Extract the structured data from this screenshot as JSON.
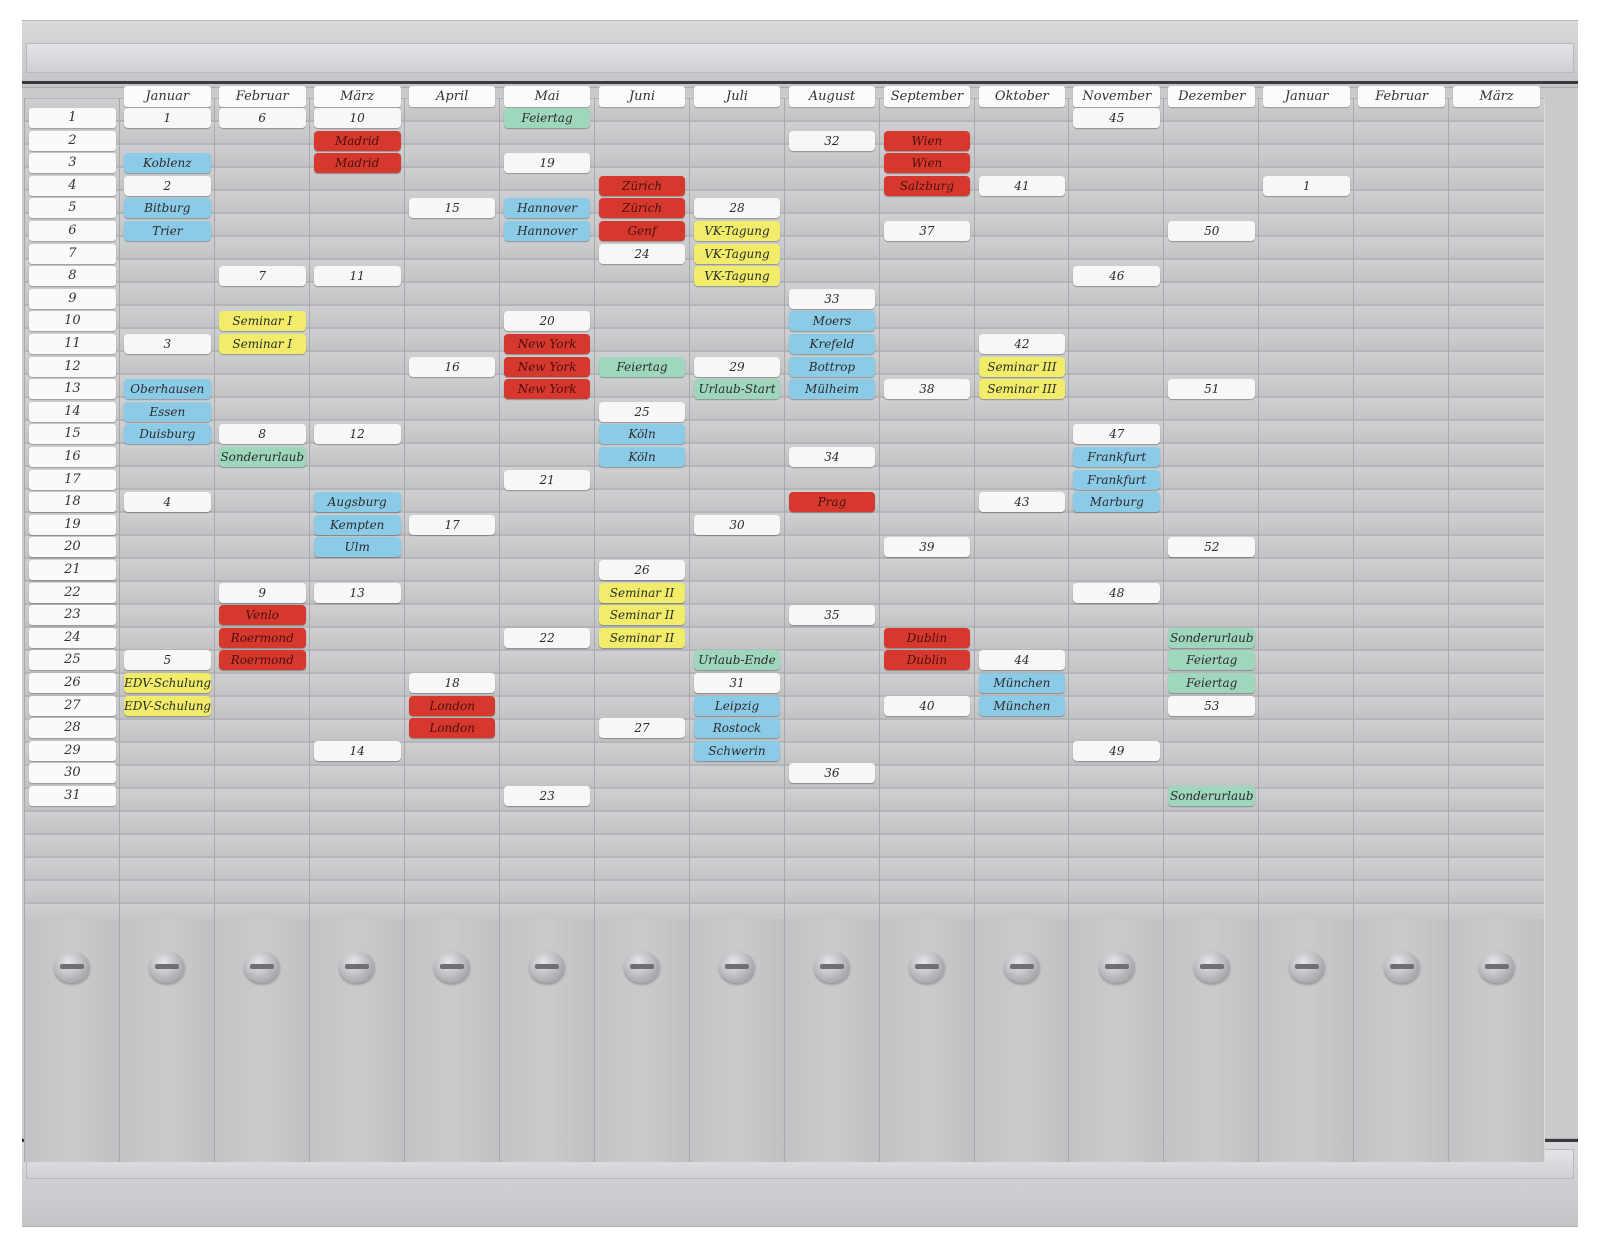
{
  "months": [
    "Januar",
    "Februar",
    "März",
    "April",
    "Mai",
    "Juni",
    "Juli",
    "August",
    "September",
    "Oktober",
    "November",
    "Dezember",
    "Januar",
    "Februar",
    "März"
  ],
  "days": [
    "1",
    "2",
    "3",
    "4",
    "5",
    "6",
    "7",
    "8",
    "9",
    "10",
    "11",
    "12",
    "13",
    "14",
    "15",
    "16",
    "17",
    "18",
    "19",
    "20",
    "21",
    "22",
    "23",
    "24",
    "25",
    "26",
    "27",
    "28",
    "29",
    "30",
    "31"
  ],
  "cards": [
    {
      "col": 1,
      "row": 1,
      "text": "1",
      "color": "white"
    },
    {
      "col": 1,
      "row": 3,
      "text": "Koblenz",
      "color": "blue"
    },
    {
      "col": 1,
      "row": 4,
      "text": "2",
      "color": "white"
    },
    {
      "col": 1,
      "row": 5,
      "text": "Bitburg",
      "color": "blue"
    },
    {
      "col": 1,
      "row": 6,
      "text": "Trier",
      "color": "blue"
    },
    {
      "col": 1,
      "row": 11,
      "text": "3",
      "color": "white"
    },
    {
      "col": 1,
      "row": 13,
      "text": "Oberhausen",
      "color": "blue"
    },
    {
      "col": 1,
      "row": 14,
      "text": "Essen",
      "color": "blue"
    },
    {
      "col": 1,
      "row": 15,
      "text": "Duisburg",
      "color": "blue"
    },
    {
      "col": 1,
      "row": 18,
      "text": "4",
      "color": "white"
    },
    {
      "col": 1,
      "row": 25,
      "text": "5",
      "color": "white"
    },
    {
      "col": 1,
      "row": 26,
      "text": "EDV-Schulung",
      "color": "yellow"
    },
    {
      "col": 1,
      "row": 27,
      "text": "EDV-Schulung",
      "color": "yellow"
    },
    {
      "col": 2,
      "row": 1,
      "text": "6",
      "color": "white"
    },
    {
      "col": 2,
      "row": 8,
      "text": "7",
      "color": "white"
    },
    {
      "col": 2,
      "row": 10,
      "text": "Seminar I",
      "color": "yellow"
    },
    {
      "col": 2,
      "row": 11,
      "text": "Seminar I",
      "color": "yellow"
    },
    {
      "col": 2,
      "row": 15,
      "text": "8",
      "color": "white"
    },
    {
      "col": 2,
      "row": 16,
      "text": "Sonderurlaub",
      "color": "green"
    },
    {
      "col": 2,
      "row": 22,
      "text": "9",
      "color": "white"
    },
    {
      "col": 2,
      "row": 23,
      "text": "Venlo",
      "color": "red"
    },
    {
      "col": 2,
      "row": 24,
      "text": "Roermond",
      "color": "red"
    },
    {
      "col": 2,
      "row": 25,
      "text": "Roermond",
      "color": "red"
    },
    {
      "col": 3,
      "row": 1,
      "text": "10",
      "color": "white"
    },
    {
      "col": 3,
      "row": 2,
      "text": "Madrid",
      "color": "red"
    },
    {
      "col": 3,
      "row": 3,
      "text": "Madrid",
      "color": "red"
    },
    {
      "col": 3,
      "row": 8,
      "text": "11",
      "color": "white"
    },
    {
      "col": 3,
      "row": 15,
      "text": "12",
      "color": "white"
    },
    {
      "col": 3,
      "row": 18,
      "text": "Augsburg",
      "color": "blue"
    },
    {
      "col": 3,
      "row": 19,
      "text": "Kempten",
      "color": "blue"
    },
    {
      "col": 3,
      "row": 20,
      "text": "Ulm",
      "color": "blue"
    },
    {
      "col": 3,
      "row": 22,
      "text": "13",
      "color": "white"
    },
    {
      "col": 3,
      "row": 29,
      "text": "14",
      "color": "white"
    },
    {
      "col": 4,
      "row": 5,
      "text": "15",
      "color": "white"
    },
    {
      "col": 4,
      "row": 12,
      "text": "16",
      "color": "white"
    },
    {
      "col": 4,
      "row": 19,
      "text": "17",
      "color": "white"
    },
    {
      "col": 4,
      "row": 26,
      "text": "18",
      "color": "white"
    },
    {
      "col": 4,
      "row": 27,
      "text": "London",
      "color": "red"
    },
    {
      "col": 4,
      "row": 28,
      "text": "London",
      "color": "red"
    },
    {
      "col": 5,
      "row": 1,
      "text": "Feiertag",
      "color": "green"
    },
    {
      "col": 5,
      "row": 3,
      "text": "19",
      "color": "white"
    },
    {
      "col": 5,
      "row": 5,
      "text": "Hannover",
      "color": "blue"
    },
    {
      "col": 5,
      "row": 6,
      "text": "Hannover",
      "color": "blue"
    },
    {
      "col": 5,
      "row": 10,
      "text": "20",
      "color": "white"
    },
    {
      "col": 5,
      "row": 11,
      "text": "New York",
      "color": "red"
    },
    {
      "col": 5,
      "row": 12,
      "text": "New York",
      "color": "red"
    },
    {
      "col": 5,
      "row": 13,
      "text": "New York",
      "color": "red"
    },
    {
      "col": 5,
      "row": 17,
      "text": "21",
      "color": "white"
    },
    {
      "col": 5,
      "row": 24,
      "text": "22",
      "color": "white"
    },
    {
      "col": 5,
      "row": 31,
      "text": "23",
      "color": "white"
    },
    {
      "col": 6,
      "row": 4,
      "text": "Zürich",
      "color": "red"
    },
    {
      "col": 6,
      "row": 5,
      "text": "Zürich",
      "color": "red"
    },
    {
      "col": 6,
      "row": 6,
      "text": "Genf",
      "color": "red"
    },
    {
      "col": 6,
      "row": 7,
      "text": "24",
      "color": "white"
    },
    {
      "col": 6,
      "row": 12,
      "text": "Feiertag",
      "color": "green"
    },
    {
      "col": 6,
      "row": 14,
      "text": "25",
      "color": "white"
    },
    {
      "col": 6,
      "row": 15,
      "text": "Köln",
      "color": "blue"
    },
    {
      "col": 6,
      "row": 16,
      "text": "Köln",
      "color": "blue"
    },
    {
      "col": 6,
      "row": 21,
      "text": "26",
      "color": "white"
    },
    {
      "col": 6,
      "row": 22,
      "text": "Seminar II",
      "color": "yellow"
    },
    {
      "col": 6,
      "row": 23,
      "text": "Seminar II",
      "color": "yellow"
    },
    {
      "col": 6,
      "row": 24,
      "text": "Seminar II",
      "color": "yellow"
    },
    {
      "col": 6,
      "row": 28,
      "text": "27",
      "color": "white"
    },
    {
      "col": 7,
      "row": 5,
      "text": "28",
      "color": "white"
    },
    {
      "col": 7,
      "row": 6,
      "text": "VK-Tagung",
      "color": "yellow"
    },
    {
      "col": 7,
      "row": 7,
      "text": "VK-Tagung",
      "color": "yellow"
    },
    {
      "col": 7,
      "row": 8,
      "text": "VK-Tagung",
      "color": "yellow"
    },
    {
      "col": 7,
      "row": 12,
      "text": "29",
      "color": "white"
    },
    {
      "col": 7,
      "row": 13,
      "text": "Urlaub-Start",
      "color": "green"
    },
    {
      "col": 7,
      "row": 19,
      "text": "30",
      "color": "white"
    },
    {
      "col": 7,
      "row": 25,
      "text": "Urlaub-Ende",
      "color": "green"
    },
    {
      "col": 7,
      "row": 26,
      "text": "31",
      "color": "white"
    },
    {
      "col": 7,
      "row": 27,
      "text": "Leipzig",
      "color": "blue"
    },
    {
      "col": 7,
      "row": 28,
      "text": "Rostock",
      "color": "blue"
    },
    {
      "col": 7,
      "row": 29,
      "text": "Schwerin",
      "color": "blue"
    },
    {
      "col": 8,
      "row": 2,
      "text": "32",
      "color": "white"
    },
    {
      "col": 8,
      "row": 9,
      "text": "33",
      "color": "white"
    },
    {
      "col": 8,
      "row": 10,
      "text": "Moers",
      "color": "blue"
    },
    {
      "col": 8,
      "row": 11,
      "text": "Krefeld",
      "color": "blue"
    },
    {
      "col": 8,
      "row": 12,
      "text": "Bottrop",
      "color": "blue"
    },
    {
      "col": 8,
      "row": 13,
      "text": "Mülheim",
      "color": "blue"
    },
    {
      "col": 8,
      "row": 16,
      "text": "34",
      "color": "white"
    },
    {
      "col": 8,
      "row": 18,
      "text": "Prag",
      "color": "red"
    },
    {
      "col": 8,
      "row": 23,
      "text": "35",
      "color": "white"
    },
    {
      "col": 8,
      "row": 30,
      "text": "36",
      "color": "white"
    },
    {
      "col": 9,
      "row": 2,
      "text": "Wien",
      "color": "red"
    },
    {
      "col": 9,
      "row": 3,
      "text": "Wien",
      "color": "red"
    },
    {
      "col": 9,
      "row": 4,
      "text": "Salzburg",
      "color": "red"
    },
    {
      "col": 9,
      "row": 6,
      "text": "37",
      "color": "white"
    },
    {
      "col": 9,
      "row": 13,
      "text": "38",
      "color": "white"
    },
    {
      "col": 9,
      "row": 20,
      "text": "39",
      "color": "white"
    },
    {
      "col": 9,
      "row": 24,
      "text": "Dublin",
      "color": "red"
    },
    {
      "col": 9,
      "row": 25,
      "text": "Dublin",
      "color": "red"
    },
    {
      "col": 9,
      "row": 27,
      "text": "40",
      "color": "white"
    },
    {
      "col": 10,
      "row": 4,
      "text": "41",
      "color": "white"
    },
    {
      "col": 10,
      "row": 11,
      "text": "42",
      "color": "white"
    },
    {
      "col": 10,
      "row": 12,
      "text": "Seminar III",
      "color": "yellow"
    },
    {
      "col": 10,
      "row": 13,
      "text": "Seminar III",
      "color": "yellow"
    },
    {
      "col": 10,
      "row": 18,
      "text": "43",
      "color": "white"
    },
    {
      "col": 10,
      "row": 25,
      "text": "44",
      "color": "white"
    },
    {
      "col": 10,
      "row": 26,
      "text": "München",
      "color": "blue"
    },
    {
      "col": 10,
      "row": 27,
      "text": "München",
      "color": "blue"
    },
    {
      "col": 11,
      "row": 1,
      "text": "45",
      "color": "white"
    },
    {
      "col": 11,
      "row": 8,
      "text": "46",
      "color": "white"
    },
    {
      "col": 11,
      "row": 15,
      "text": "47",
      "color": "white"
    },
    {
      "col": 11,
      "row": 16,
      "text": "Frankfurt",
      "color": "blue"
    },
    {
      "col": 11,
      "row": 17,
      "text": "Frankfurt",
      "color": "blue"
    },
    {
      "col": 11,
      "row": 18,
      "text": "Marburg",
      "color": "blue"
    },
    {
      "col": 11,
      "row": 22,
      "text": "48",
      "color": "white"
    },
    {
      "col": 11,
      "row": 29,
      "text": "49",
      "color": "white"
    },
    {
      "col": 12,
      "row": 6,
      "text": "50",
      "color": "white"
    },
    {
      "col": 12,
      "row": 13,
      "text": "51",
      "color": "white"
    },
    {
      "col": 12,
      "row": 20,
      "text": "52",
      "color": "white"
    },
    {
      "col": 12,
      "row": 24,
      "text": "Sonderurlaub",
      "color": "green"
    },
    {
      "col": 12,
      "row": 25,
      "text": "Feiertag",
      "color": "green"
    },
    {
      "col": 12,
      "row": 26,
      "text": "Feiertag",
      "color": "green"
    },
    {
      "col": 12,
      "row": 27,
      "text": "53",
      "color": "white"
    },
    {
      "col": 12,
      "row": 31,
      "text": "Sonderurlaub",
      "color": "green"
    },
    {
      "col": 13,
      "row": 4,
      "text": "1",
      "color": "white"
    }
  ]
}
